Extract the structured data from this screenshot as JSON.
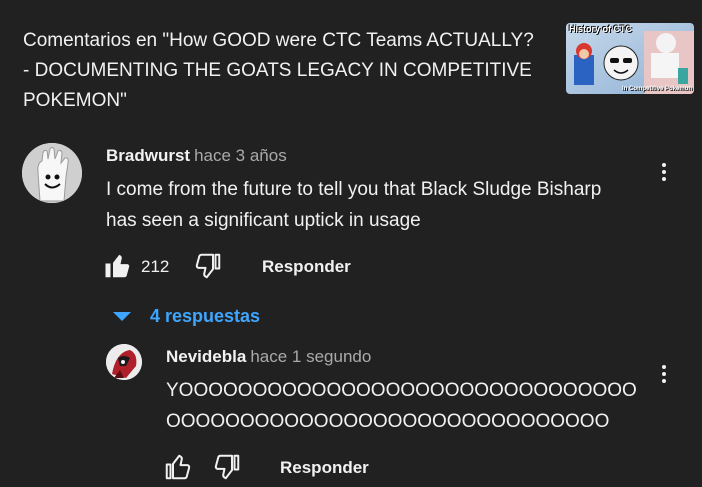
{
  "header": {
    "title": "Comentarios en \"How GOOD were CTC Teams ACTUALLY? - DOCUMENTING THE GOATS LEGACY IN COMPETITIVE POKEMON\"",
    "thumbnail": {
      "title_text": "History of CTC",
      "subtitle_text": "In Competitive Pokemon"
    }
  },
  "comment": {
    "author": "Bradwurst",
    "time": "hace 3 años",
    "text": "I come from the future to tell you that Black Sludge Bisharp has seen a significant uptick in usage",
    "like_count": "212",
    "reply_label": "Responder"
  },
  "replies_toggle": {
    "label": "4 respuestas"
  },
  "reply": {
    "author": "Nevidebla",
    "time": "hace 1 segundo",
    "text": "YOOOOOOOOOOOOOOOOOOOOOOOOOOOOOOOOOOOOOOOOOOOOOOOOOOOOOOOOOOOOO",
    "reply_label": "Responder"
  },
  "colors": {
    "background": "#212121",
    "text": "#f1f1f1",
    "muted": "#aaaaaa",
    "link": "#3ea6ff"
  }
}
